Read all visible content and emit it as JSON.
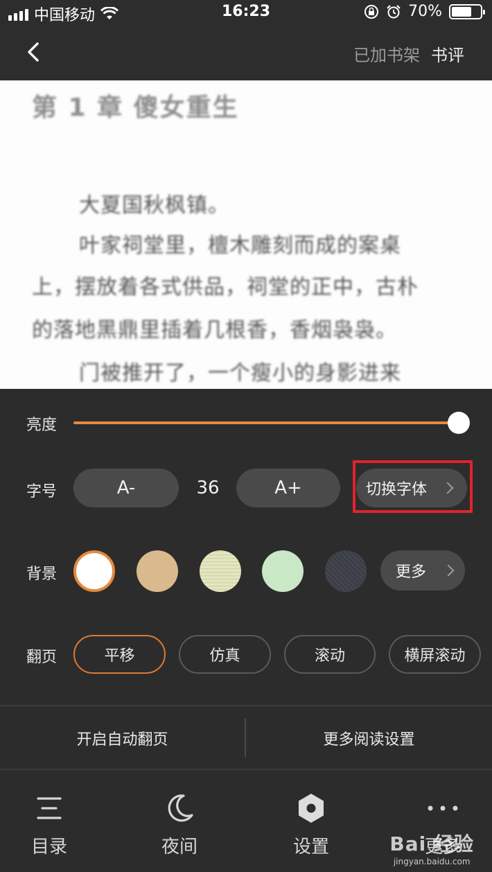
{
  "status_bar": {
    "carrier": "中国移动",
    "time": "16:23",
    "battery": "70%",
    "battery_level": 0.7
  },
  "header": {
    "added_to_shelf": "已加书架",
    "review": "书评"
  },
  "content": {
    "chapter_title": "第 1 章 傻女重生",
    "lines": [
      "大夏国秋枫镇。",
      "叶家祠堂里，檀木雕刻而成的案桌",
      "上，摆放着各式供品，祠堂的正中，古朴",
      "的落地黑鼎里插着几根香，香烟袅袅。",
      "门被推开了，一个瘦小的身影进来"
    ]
  },
  "settings": {
    "brightness": {
      "label": "亮度",
      "level": 1.0
    },
    "font_size": {
      "label": "字号",
      "decrease": "A-",
      "value": "36",
      "increase": "A+",
      "switch_font": "切换字体"
    },
    "background": {
      "label": "背景",
      "swatches": [
        {
          "name": "white",
          "color": "#ffffff",
          "selected": true
        },
        {
          "name": "tan",
          "color": "#d9b98e",
          "selected": false
        },
        {
          "name": "pale-green-stripe",
          "color": "#d9dcae",
          "selected": false
        },
        {
          "name": "mint",
          "color": "#c9e8c6",
          "selected": false
        },
        {
          "name": "dark-pattern",
          "color": "#3a3d45",
          "selected": false
        }
      ],
      "more": "更多"
    },
    "page_turn": {
      "label": "翻页",
      "options": [
        "平移",
        "仿真",
        "滚动",
        "横屏滚动"
      ],
      "selected_index": 0
    },
    "auto_turn": "开启自动翻页",
    "more_reading": "更多阅读设置"
  },
  "bottom_nav": {
    "items": [
      {
        "label": "目录",
        "icon": "menu-lines-icon"
      },
      {
        "label": "夜间",
        "icon": "moon-icon"
      },
      {
        "label": "设置",
        "icon": "hexagon-gear-icon"
      },
      {
        "label": "更多",
        "icon": "more-dots-icon"
      }
    ]
  },
  "watermark": {
    "brand": "Bai 经验",
    "url": "jingyan.baidu.com"
  },
  "colors": {
    "accent": "#e58a3f",
    "highlight_box": "#e0232b",
    "panel_bg": "#2c2c2c"
  }
}
